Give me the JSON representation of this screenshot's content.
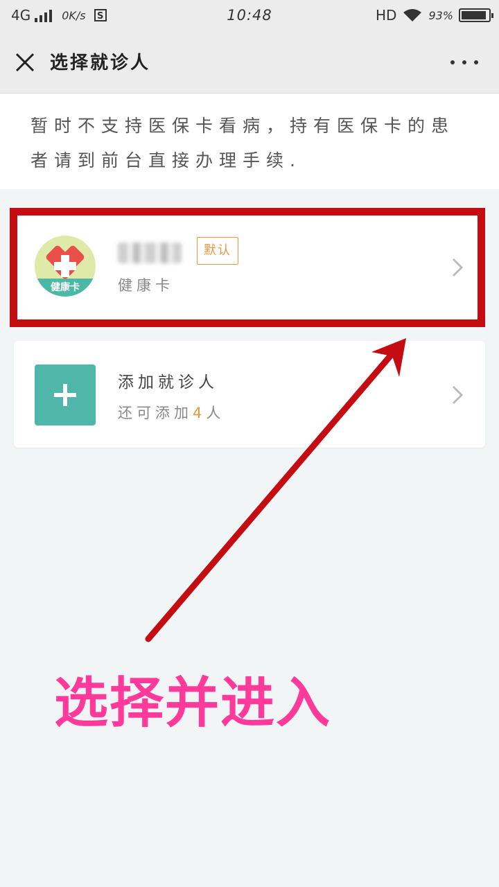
{
  "status_bar": {
    "network": "4G",
    "speed": "0K/s",
    "s_icon": "S",
    "time": "10:48",
    "hd": "HD",
    "battery_percent": "93%",
    "battery_level": 0.93
  },
  "header": {
    "title": "选择就诊人",
    "close_icon": "close-icon",
    "more_icon": "more-icon"
  },
  "notice": {
    "text": "暂时不支持医保卡看病，持有医保卡的患者请到前台直接办理手续."
  },
  "patient_card": {
    "name": "",
    "default_badge": "默认",
    "subtitle": "健康卡",
    "avatar_label": "健康卡"
  },
  "add_card": {
    "title": "添加就诊人",
    "subtitle_prefix": "还可添加",
    "count": "4",
    "subtitle_suffix": "人"
  },
  "annotation": {
    "caption": "选择并进入",
    "color": "#ff3a9a",
    "highlight_color": "#c40d12"
  }
}
